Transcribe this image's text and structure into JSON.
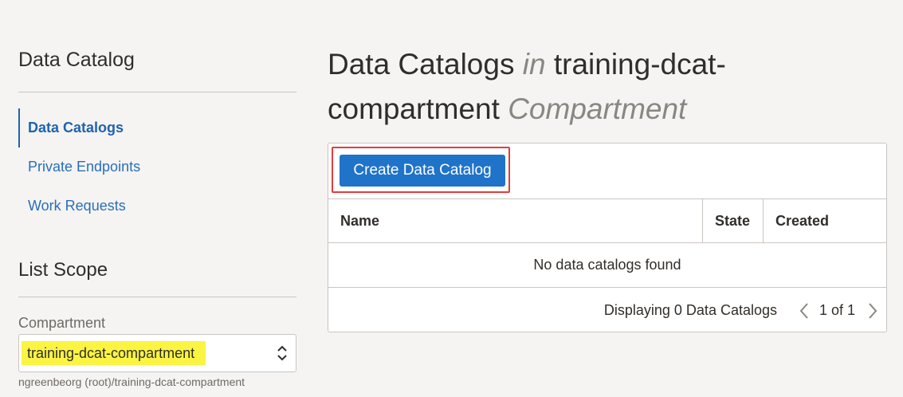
{
  "sidebar": {
    "title": "Data Catalog",
    "nav": [
      {
        "label": "Data Catalogs",
        "active": true
      },
      {
        "label": "Private Endpoints",
        "active": false
      },
      {
        "label": "Work Requests",
        "active": false
      }
    ],
    "list_scope": {
      "title": "List Scope",
      "compartment_label": "Compartment",
      "compartment_value": "training-dcat-compartment",
      "compartment_path": "ngreenbeorg (root)/training-dcat-compartment"
    }
  },
  "main": {
    "title_prefix": "Data Catalogs",
    "title_in": "in",
    "title_compartment": "training-dcat-compartment",
    "title_suffix": "Compartment",
    "create_button": "Create Data Catalog",
    "table": {
      "columns": [
        "Name",
        "State",
        "Created"
      ],
      "empty_message": "No data catalogs found"
    },
    "footer": {
      "display_count": "Displaying 0 Data Catalogs",
      "page_label": "1 of 1"
    }
  },
  "colors": {
    "link": "#2a6ebb",
    "primary_button": "#1f73c9",
    "highlight_box": "#e03d3d",
    "selection_highlight": "#fbf442"
  },
  "icons": {
    "select_chevron": "chevron-up-down-icon",
    "prev_page": "chevron-left-icon",
    "next_page": "chevron-right-icon"
  }
}
